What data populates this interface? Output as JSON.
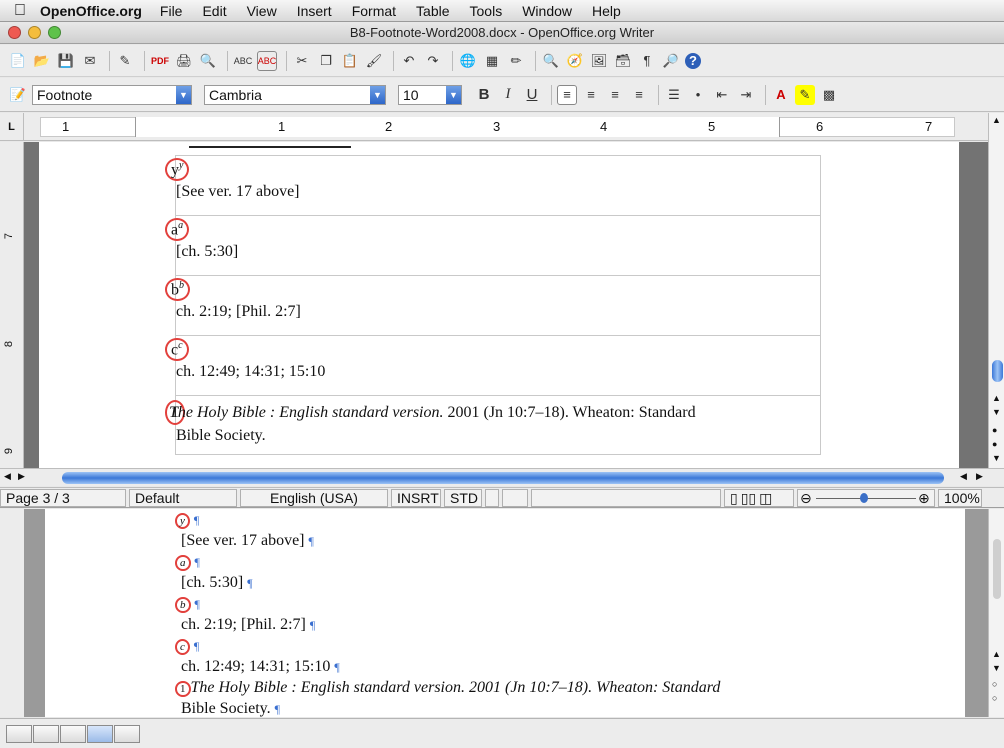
{
  "menubar": {
    "app_name": "OpenOffice.org",
    "items": [
      "File",
      "Edit",
      "View",
      "Insert",
      "Format",
      "Table",
      "Tools",
      "Window",
      "Help"
    ]
  },
  "window": {
    "title": "B8-Footnote-Word2008.docx - OpenOffice.org Writer"
  },
  "toolbar_format": {
    "paragraph_style": "Footnote",
    "font_name": "Cambria",
    "font_size": "10",
    "bold": "B",
    "italic": "I",
    "underline": "U"
  },
  "ruler": {
    "corner": "L",
    "labels": [
      "1",
      "1",
      "2",
      "3",
      "4",
      "5",
      "6",
      "7"
    ]
  },
  "vertical_ruler": [
    "7",
    "8",
    "9"
  ],
  "footnotes_top": [
    {
      "mark": "y",
      "sup": "y",
      "text": "[See ver. 17 above]"
    },
    {
      "mark": "a",
      "sup": "a",
      "text": "[ch. 5:30]"
    },
    {
      "mark": "b",
      "sup": "b",
      "text": "ch. 2:19; [Phil. 2:7]"
    },
    {
      "mark": "c",
      "sup": "c",
      "text": "ch. 12:49; 14:31; 15:10"
    },
    {
      "mark": "1",
      "italic": "The Holy Bible : English standard version.",
      "text": " 2001 (Jn 10:7–18). Wheaton: Standard",
      "text2": "Bible Society."
    }
  ],
  "status": {
    "page": "Page 3 / 3",
    "style": "Default",
    "language": "English (USA)",
    "insert_mode": "INSRT",
    "selection_mode": "STD",
    "zoom": "100%"
  },
  "footnotes_bottom": [
    {
      "mark": "y",
      "pilcrow": "¶"
    },
    {
      "text": "[See ver. 17 above]",
      "pilcrow": "¶"
    },
    {
      "mark": "a",
      "pilcrow": "¶"
    },
    {
      "text": "[ch. 5:30]",
      "pilcrow": "¶"
    },
    {
      "mark": "b",
      "pilcrow": "¶"
    },
    {
      "text": "ch. 2:19; [Phil. 2:7]",
      "pilcrow": "¶"
    },
    {
      "mark": "c",
      "pilcrow": "¶"
    },
    {
      "text": "ch. 12:49; 14:31; 15:10",
      "pilcrow": "¶"
    },
    {
      "mark": "1",
      "italic": "The",
      "text": " Holy Bible : English standard version. 2001 (Jn 10:7–18). Wheaton: Standard"
    },
    {
      "text": "Bible Society.",
      "pilcrow": "¶"
    }
  ],
  "colors": {
    "annotation_circle": "#e2403c",
    "pilcrow": "#3a6fd0",
    "scroll_accent": "#3b78d8"
  }
}
